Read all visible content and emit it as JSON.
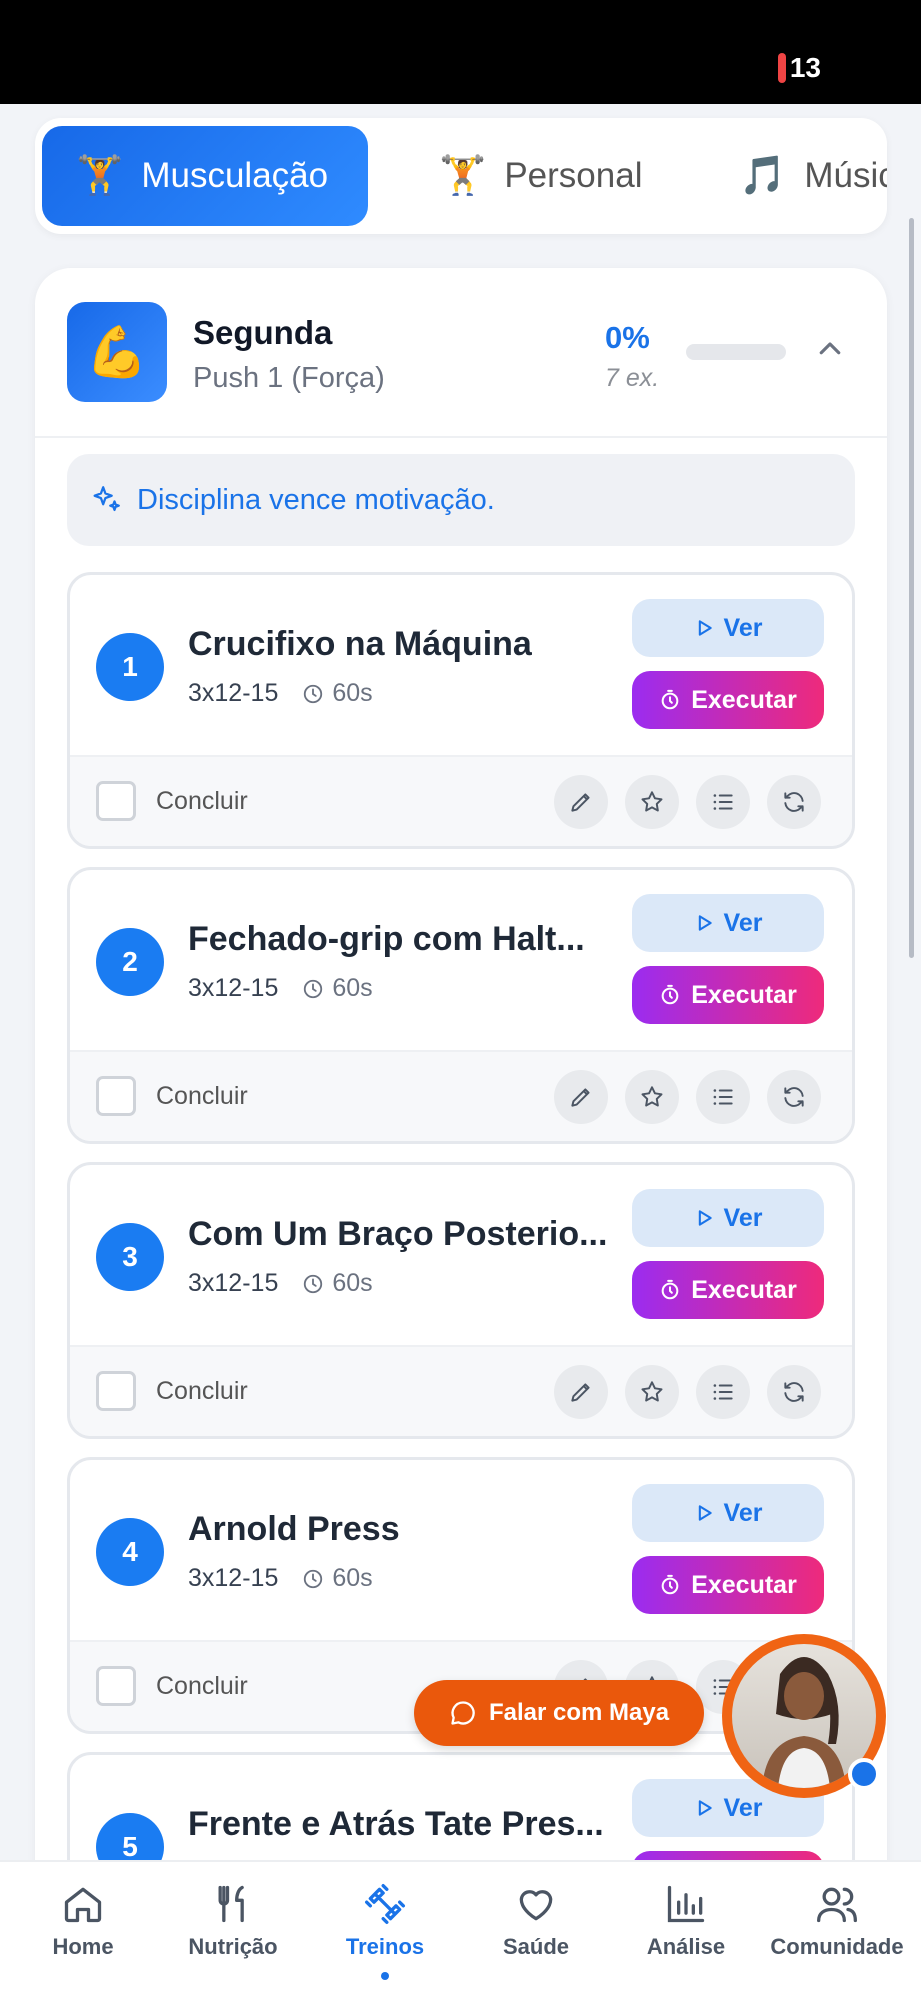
{
  "status": {
    "battery": "13"
  },
  "tabs": [
    {
      "emoji": "🏋️",
      "label": "Musculação"
    },
    {
      "emoji": "🏋️",
      "label": "Personal"
    },
    {
      "emoji": "🎵",
      "label": "Música"
    }
  ],
  "day": {
    "emoji": "💪",
    "title": "Segunda",
    "subtitle": "Push 1 (Força)",
    "percent": "0%",
    "progress": 0,
    "count": "7 ex.",
    "quote": "Disciplina vence motivação."
  },
  "exercises": [
    {
      "num": "1",
      "name": "Crucifixo na Máquina",
      "sets": "3x12-15",
      "rest": "60s"
    },
    {
      "num": "2",
      "name": "Fechado-grip com Halt...",
      "sets": "3x12-15",
      "rest": "60s"
    },
    {
      "num": "3",
      "name": "Com Um Braço Posterio...",
      "sets": "3x12-15",
      "rest": "60s"
    },
    {
      "num": "4",
      "name": "Arnold Press",
      "sets": "3x12-15",
      "rest": "60s"
    },
    {
      "num": "5",
      "name": "Frente e Atrás Tate Pres...",
      "sets": "",
      "rest": ""
    }
  ],
  "labels": {
    "ver": "Ver",
    "executar": "Executar",
    "concluir": "Concluir"
  },
  "maya": {
    "label": "Falar com Maya"
  },
  "nav": [
    {
      "label": "Home",
      "icon": "home-icon"
    },
    {
      "label": "Nutrição",
      "icon": "utensils-icon"
    },
    {
      "label": "Treinos",
      "icon": "dumbbell-icon"
    },
    {
      "label": "Saúde",
      "icon": "heart-icon"
    },
    {
      "label": "Análise",
      "icon": "bar-chart-icon"
    },
    {
      "label": "Comunidade",
      "icon": "users-icon"
    }
  ],
  "colors": {
    "primary": "#1a73e8",
    "accent_orange": "#ea580c",
    "exec_gradient_start": "#9b2cf0",
    "exec_gradient_end": "#ee2a7b"
  }
}
